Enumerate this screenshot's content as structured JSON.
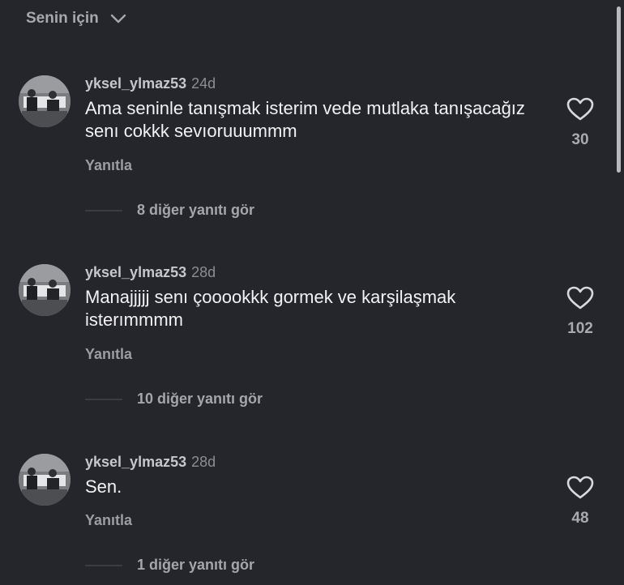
{
  "header": {
    "filter_label": "Senin için"
  },
  "comments": [
    {
      "username": "yksel_ylmaz53",
      "time": "24d",
      "text": "Ama seninle tanışmak isterim vede mutlaka tanışacağız senı cokkk sevıoruuummm",
      "reply_label": "Yanıtla",
      "likes": "30",
      "more_replies_label": "8 diğer yanıtı gör"
    },
    {
      "username": "yksel_ylmaz53",
      "time": "28d",
      "text": "Manajjjjj senı çooookkk gormek ve karşilaşmak isterımmmm",
      "reply_label": "Yanıtla",
      "likes": "102",
      "more_replies_label": "10 diğer yanıtı gör"
    },
    {
      "username": "yksel_ylmaz53",
      "time": "28d",
      "text": "Sen.",
      "reply_label": "Yanıtla",
      "likes": "48",
      "more_replies_label": "1 diğer yanıtı gör"
    }
  ],
  "icons": {
    "filter_chevron": "chevron-down-icon",
    "like": "heart-outline-icon"
  },
  "colors": {
    "background": "#25262b",
    "text_primary": "#f2f2f4",
    "text_secondary": "#9c9da2"
  }
}
